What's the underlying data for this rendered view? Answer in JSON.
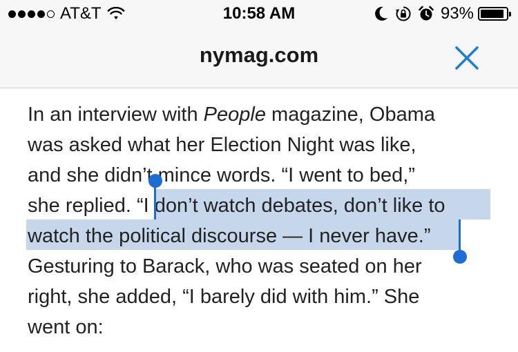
{
  "status_bar": {
    "carrier": "AT&T",
    "signal_bars_filled": 4,
    "signal_bars_total": 5,
    "time": "10:58 AM",
    "battery_percent": "93%",
    "battery_level": 0.93,
    "icons": [
      "signal-icon",
      "wifi-icon",
      "moon-icon",
      "rotation-lock-icon",
      "alarm-icon",
      "battery-icon"
    ]
  },
  "nav": {
    "title": "nymag.com",
    "close_icon": "close-icon",
    "accent_color": "#1c7ed6"
  },
  "article": {
    "selection_color": "#c6d7ec",
    "handle_color": "#1c6ed6",
    "line1_pre": "In an interview with ",
    "line1_italic": "People",
    "line1_post": " magazine, Obama",
    "line2": "was asked what her Election Night was like,",
    "line3": "and she didn’t mince words. “I went to bed,”",
    "line4_pre": "she replied. “",
    "line4_sel": "I don’t watch debates, don’t like to",
    "line5_sel": "watch the political discourse — I never have",
    "line5_post": ".”",
    "line6": "Gesturing to Barack, who was seated on her",
    "line7": "right, she added, “I barely did with him.” She",
    "line8": "went on:"
  }
}
